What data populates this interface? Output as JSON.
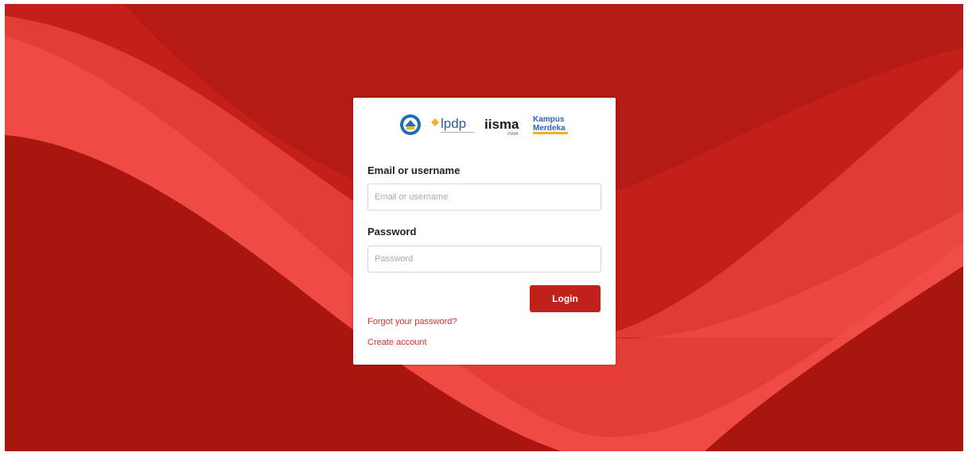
{
  "brand": {
    "logos": {
      "kemdikbud": "Kemdikbud",
      "lpdp": "lpdp",
      "iisma": "iisma",
      "iisma_sub": "IISMA",
      "kampus_line1": "Kampus",
      "kampus_line2": "Merdeka"
    },
    "colors": {
      "background": "#c41f18",
      "accent": "#c0211b",
      "link": "#d0342c"
    }
  },
  "login_form": {
    "email_label": "Email or username",
    "email_placeholder": "Email or username",
    "email_value": "",
    "password_label": "Password",
    "password_placeholder": "Password",
    "password_value": "",
    "login_button": "Login",
    "forgot_password_link": "Forgot your password?",
    "create_account_link": "Create account"
  }
}
